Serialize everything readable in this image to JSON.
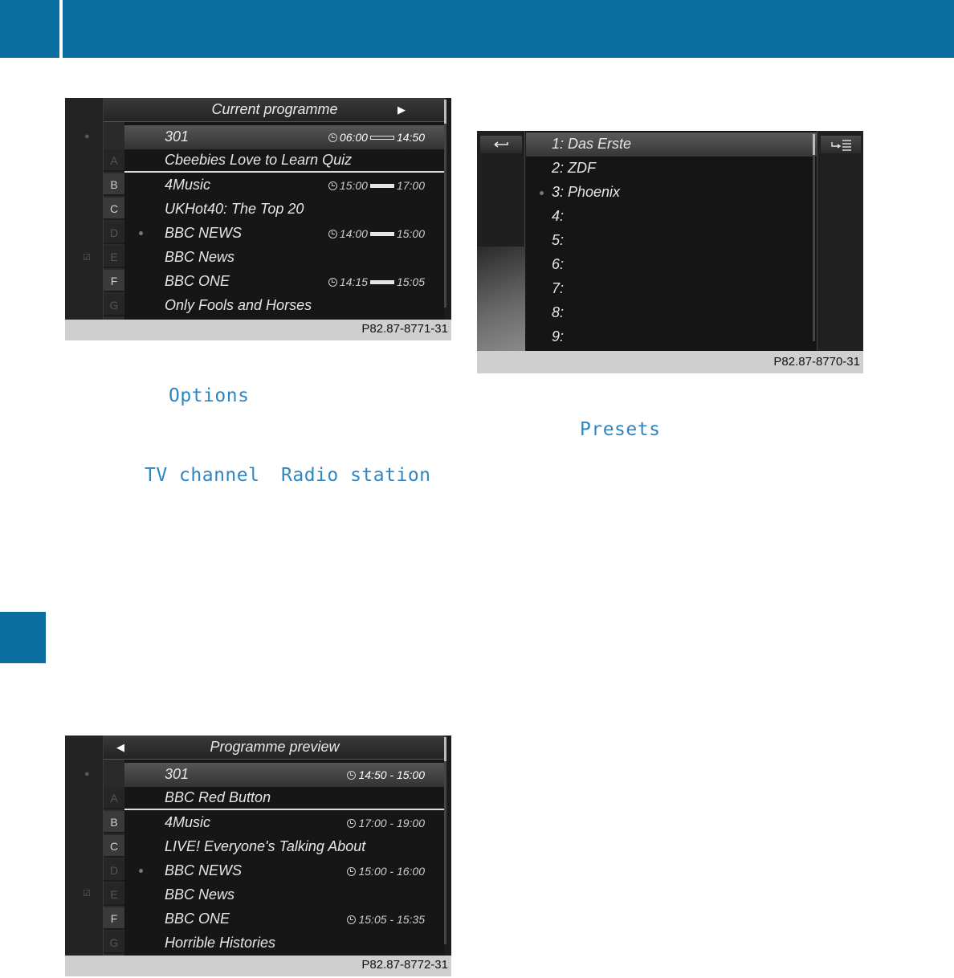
{
  "keywords": {
    "options": "Options",
    "tv_channel": "TV channel",
    "radio_station": "Radio station",
    "presets": "Presets"
  },
  "screen1": {
    "title": "Current programme",
    "caption": "P82.87-8771-31",
    "letters": [
      "A",
      "B",
      "C",
      "D",
      "E",
      "F",
      "G"
    ],
    "rows": [
      {
        "text": "301",
        "start": "06:00",
        "end": "14:50"
      },
      {
        "text": "Cbeebies Love to Learn Quiz"
      },
      {
        "text": "4Music",
        "start": "15:00",
        "end": "17:00"
      },
      {
        "text": "UKHot40: The Top 20"
      },
      {
        "text": "BBC NEWS",
        "start": "14:00",
        "end": "15:00"
      },
      {
        "text": "BBC News"
      },
      {
        "text": "BBC ONE",
        "start": "14:15",
        "end": "15:05"
      },
      {
        "text": "Only Fools and Horses"
      }
    ]
  },
  "screen2": {
    "caption": "P82.87-8770-31",
    "presets": [
      "1: Das Erste",
      "2: ZDF",
      "3: Phoenix",
      "4:",
      "5:",
      "6:",
      "7:",
      "8:",
      "9:"
    ]
  },
  "screen3": {
    "title": "Programme preview",
    "caption": "P82.87-8772-31",
    "letters": [
      "A",
      "B",
      "C",
      "D",
      "E",
      "F",
      "G"
    ],
    "rows": [
      {
        "text": "301",
        "time": "14:50 - 15:00"
      },
      {
        "text": "BBC Red Button"
      },
      {
        "text": "4Music",
        "time": "17:00 - 19:00"
      },
      {
        "text": "LIVE! Everyone's Talking About"
      },
      {
        "text": "BBC NEWS",
        "time": "15:00 - 16:00"
      },
      {
        "text": "BBC News"
      },
      {
        "text": "BBC ONE",
        "time": "15:05 - 15:35"
      },
      {
        "text": "Horrible Histories"
      }
    ]
  }
}
